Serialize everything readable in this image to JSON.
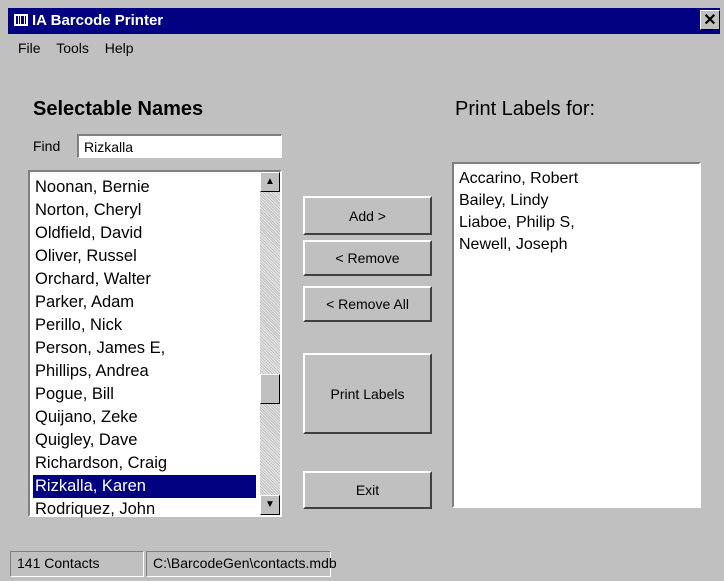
{
  "window": {
    "title": "IA Barcode Printer",
    "close_glyph": "✕"
  },
  "menu": {
    "file": "File",
    "tools": "Tools",
    "help": "Help"
  },
  "left": {
    "heading": "Selectable Names",
    "find_label": "Find",
    "find_value": "Rizkalla",
    "items": [
      "Noonan, Bernie",
      "Norton, Cheryl",
      "Oldfield, David",
      "Oliver, Russel",
      "Orchard, Walter",
      "Parker, Adam",
      "Perillo, Nick",
      "Person, James E,",
      "Phillips, Andrea",
      "Pogue, Bill",
      "Quijano, Zeke",
      "Quigley, Dave",
      "Richardson, Craig",
      "Rizkalla, Karen",
      "Rodriquez, John"
    ],
    "selected_item": "Rizkalla, Karen"
  },
  "buttons": {
    "add": "Add >",
    "remove": "< Remove",
    "remove_all": "< Remove All",
    "print": "Print Labels",
    "exit": "Exit"
  },
  "right": {
    "heading": "Print Labels for:",
    "items": [
      "Accarino, Robert",
      "Bailey, Lindy",
      "Liaboe, Philip S,",
      "Newell, Joseph"
    ]
  },
  "status": {
    "count": "141 Contacts",
    "path": "C:\\BarcodeGen\\contacts.mdb"
  },
  "colors": {
    "selection": "#000080",
    "face": "#c0c0c0"
  }
}
